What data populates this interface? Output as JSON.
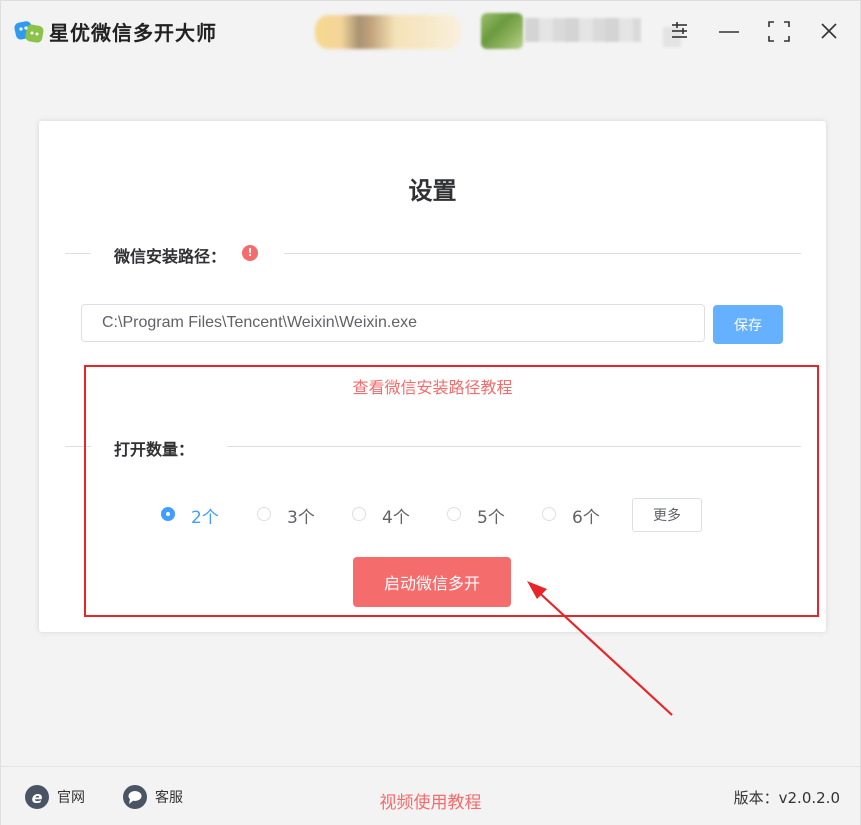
{
  "app": {
    "title": "星优微信多开大师"
  },
  "window_controls": [
    "settings-sliders-icon",
    "minimize-icon",
    "maximize-icon",
    "close-icon"
  ],
  "settings": {
    "title": "设置",
    "install_path_label": "微信安装路径：",
    "install_path_value": "C:\\Program Files\\Tencent\\Weixin\\Weixin.exe",
    "save_label": "保存",
    "tutorial_link": "查看微信安装路径教程",
    "open_count_label": "打开数量：",
    "count_options": [
      {
        "label": "2个",
        "checked": true
      },
      {
        "label": "3个",
        "checked": false
      },
      {
        "label": "4个",
        "checked": false
      },
      {
        "label": "5个",
        "checked": false
      },
      {
        "label": "6个",
        "checked": false
      }
    ],
    "more_label": "更多",
    "start_label": "启动微信多开"
  },
  "footer": {
    "website_label": "官网",
    "support_label": "客服",
    "video_tutorial": "视频使用教程",
    "version": "版本：v2.0.2.0"
  },
  "colors": {
    "primary": "#409eff",
    "save_button": "#66b1ff",
    "danger": "#f56c6c",
    "annotation": "#e8262a"
  }
}
